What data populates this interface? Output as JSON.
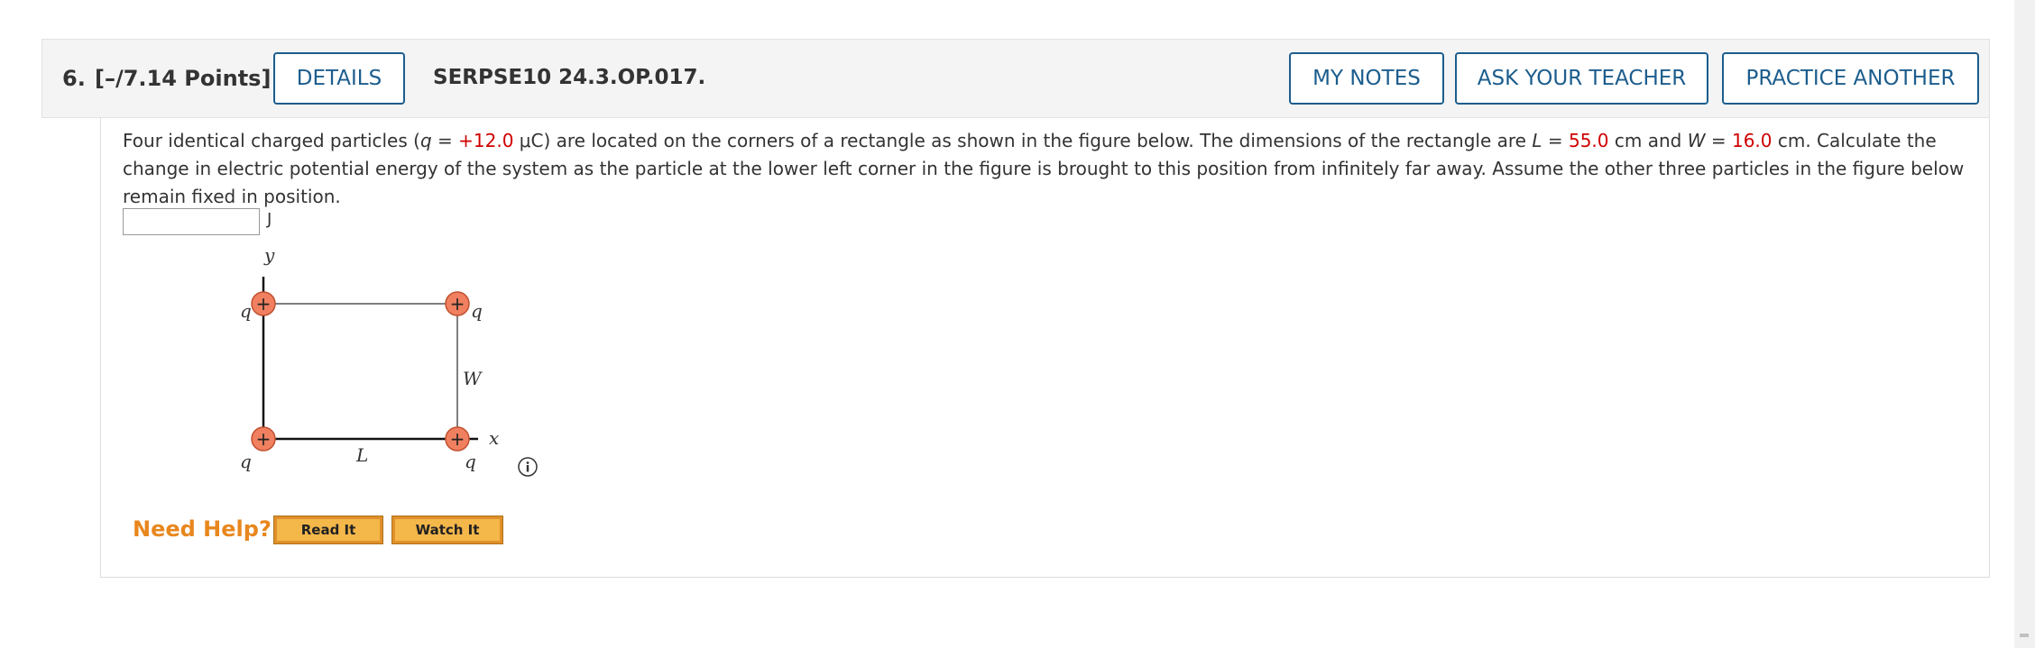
{
  "question": {
    "number": "6.",
    "points": "[–/7.14 Points]",
    "details_label": "DETAILS",
    "code": "SERPSE10 24.3.OP.017.",
    "my_notes_label": "MY NOTES",
    "ask_teacher_label": "ASK YOUR TEACHER",
    "practice_another_label": "PRACTICE ANOTHER"
  },
  "body": {
    "text_1": "Four identical charged particles (",
    "q_symbol": "q",
    "equals_1": " = ",
    "q_value": "+12.0",
    "text_2": " μC) are located on the corners of a rectangle as shown in the figure below. The dimensions of the rectangle are ",
    "L_symbol": "L",
    "equals_2": " = ",
    "L_value": "55.0",
    "text_3": " cm and ",
    "W_symbol": "W",
    "equals_3": " = ",
    "W_value": "16.0",
    "text_4": " cm. Calculate the change in electric potential energy of the system as the particle at the lower left corner in the figure is brought to this position from infinitely far away. Assume the other three particles in the figure below remain fixed in position."
  },
  "answer": {
    "value": "",
    "placeholder": "",
    "unit": "J"
  },
  "figure": {
    "y_axis_label": "y",
    "x_axis_label": "x",
    "charge_label": "q",
    "charge_sign": "+",
    "width_label": "W",
    "length_label": "L"
  },
  "help": {
    "label": "Need Help?",
    "read_it": "Read It",
    "watch_it": "Watch It"
  },
  "colors": {
    "accent": "#1c5d8d",
    "value_red": "#d00000",
    "help_orange": "#e8871e",
    "charge_fill": "#f08060"
  }
}
